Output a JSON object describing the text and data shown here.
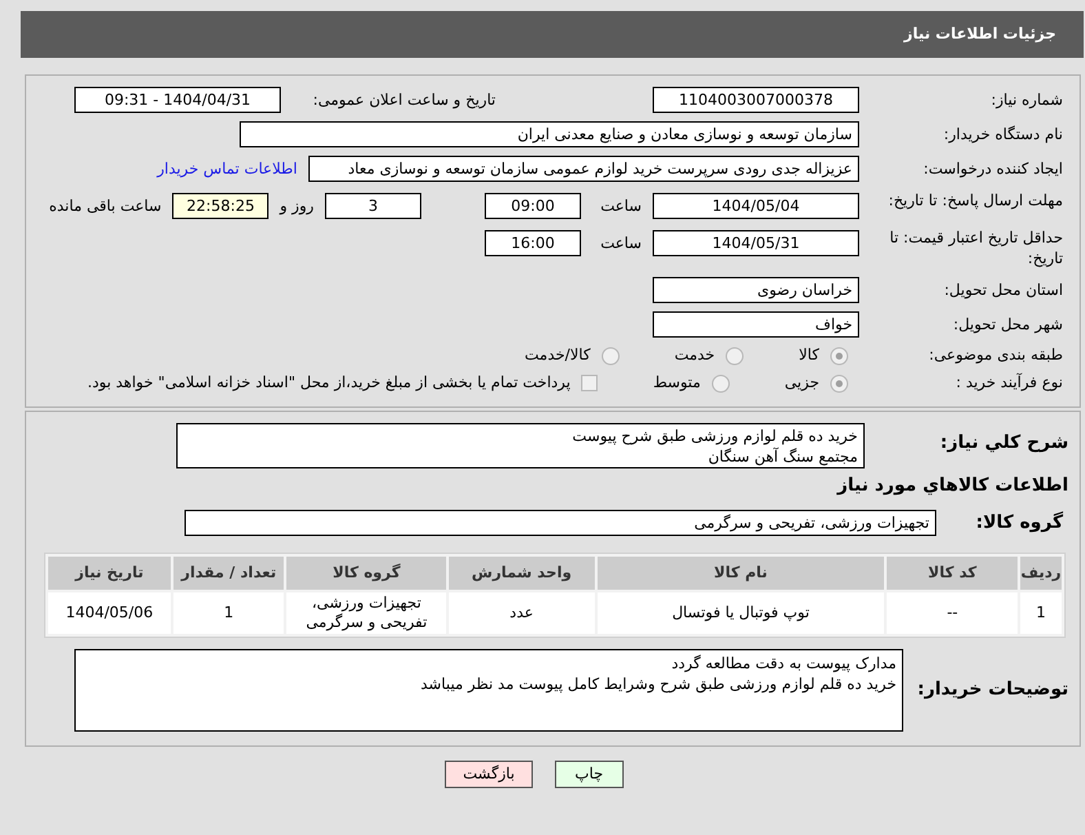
{
  "header": {
    "title": "جزئیات اطلاعات نیاز"
  },
  "details": {
    "need_number": {
      "label": "شماره نیاز:",
      "value": "1104003007000378"
    },
    "announce": {
      "label": "تاریخ و ساعت اعلان عمومی:",
      "value": "1404/04/31 - 09:31"
    },
    "buyer_org": {
      "label": "نام دستگاه خریدار:",
      "value": "سازمان توسعه و نوسازی معادن و صنایع معدنی ایران"
    },
    "requester": {
      "label": "ایجاد کننده درخواست:",
      "value": "عزیزاله جدی رودی سرپرست خرید لوازم عمومی  سازمان توسعه و نوسازی معاد",
      "link": "اطلاعات تماس خریدار"
    },
    "deadline": {
      "label": "مهلت ارسال پاسخ: تا تاریخ:",
      "date": "1404/05/04",
      "time_label": "ساعت",
      "time": "09:00",
      "days": "3",
      "days_label": "روز و",
      "remaining": "22:58:25",
      "remaining_label": "ساعت باقی مانده"
    },
    "validity": {
      "label": "حداقل تاریخ اعتبار قیمت: تا تاریخ:",
      "date": "1404/05/31",
      "time_label": "ساعت",
      "time": "16:00"
    },
    "province": {
      "label": "استان محل تحویل:",
      "value": "خراسان رضوی"
    },
    "city": {
      "label": "شهر محل تحویل:",
      "value": "خواف"
    },
    "category": {
      "label": "طبقه بندی موضوعی:",
      "options": [
        {
          "label": "کالا",
          "selected": true
        },
        {
          "label": "خدمت",
          "selected": false
        },
        {
          "label": "کالا/خدمت",
          "selected": false
        }
      ]
    },
    "process": {
      "label": "نوع فرآیند خرید :",
      "options": [
        {
          "label": "جزیی",
          "selected": true
        },
        {
          "label": "متوسط",
          "selected": false
        }
      ],
      "treasury": {
        "label": "پرداخت تمام یا بخشی از مبلغ خرید،از محل \"اسناد خزانه اسلامی\" خواهد بود.",
        "checked": false
      }
    }
  },
  "goods": {
    "description": {
      "label": "شرح کلي نياز:",
      "lines": [
        "خرید ده قلم لوازم ورزشی طبق شرح پیوست",
        "مجتمع سنگ آهن سنگان"
      ]
    },
    "heading": "اطلاعات کالاهاي مورد نياز",
    "group": {
      "label": "گروه کالا:",
      "value": "تجهیزات ورزشی، تفریحی و سرگرمی"
    },
    "table": {
      "columns": [
        "ردیف",
        "کد کالا",
        "نام کالا",
        "واحد شمارش",
        "گروه کالا",
        "تعداد / مقدار",
        "تاریخ نیاز"
      ],
      "rows": [
        [
          "1",
          "--",
          "توپ فوتبال یا فوتسال",
          "عدد",
          "تجهیزات ورزشی، تفریحی و سرگرمی",
          "1",
          "1404/05/06"
        ]
      ]
    },
    "buyer_notes": {
      "label": "توضیحات خریدار:",
      "lines": [
        "مدارک پیوست به دقت مطالعه گردد",
        "خرید ده قلم لوازم ورزشی طبق شرح وشرایط کامل پیوست مد نظر میباشد"
      ]
    }
  },
  "buttons": [
    {
      "label": "چاپ",
      "kind": "print"
    },
    {
      "label": "بازگشت",
      "kind": "back"
    }
  ]
}
